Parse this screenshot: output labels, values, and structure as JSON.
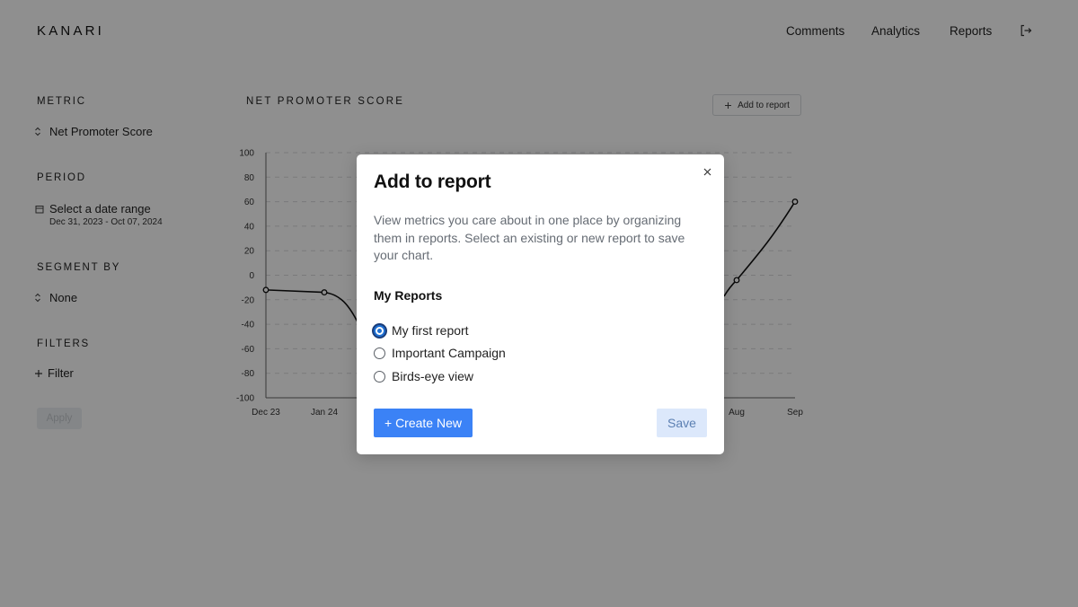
{
  "header": {
    "logo": "KANARI",
    "nav": [
      {
        "label": "Comments"
      },
      {
        "label": "Analytics"
      },
      {
        "label": "Reports"
      }
    ]
  },
  "sidebar": {
    "metric_title": "METRIC",
    "metric_value": "Net Promoter Score",
    "period_title": "PERIOD",
    "period_placeholder": "Select a date range",
    "period_range": "Dec 31, 2023 - Oct 07, 2024",
    "segment_title": "SEGMENT BY",
    "segment_value": "None",
    "filters_title": "FILTERS",
    "filter_label": "Filter",
    "apply_label": "Apply"
  },
  "chart": {
    "title": "NET PROMOTER SCORE",
    "add_to_report_label": "Add to report"
  },
  "chart_data": {
    "type": "line",
    "title": "NET PROMOTER SCORE",
    "xlabel": "",
    "ylabel": "",
    "ylim": [
      -100,
      100
    ],
    "yticks": [
      100,
      80,
      60,
      40,
      20,
      0,
      -20,
      -40,
      -60,
      -80,
      -100
    ],
    "grid": true,
    "x_tick_labels": [
      "Dec 23",
      "Jan 24",
      "Aug",
      "Sep"
    ],
    "series": [
      {
        "values_visible": [
          {
            "x": "Dec 23",
            "y": -12
          },
          {
            "x": "Jan 24",
            "y": -14
          },
          {
            "x": "Aug",
            "y": -4
          },
          {
            "x": "Sep",
            "y": 60
          }
        ]
      }
    ]
  },
  "modal": {
    "title": "Add to report",
    "description": "View metrics you care about in one place by organizing them in reports. Select an existing or new report to save your chart.",
    "subtitle": "My Reports",
    "options": [
      {
        "label": "My first report",
        "checked": true
      },
      {
        "label": "Important Campaign",
        "checked": false
      },
      {
        "label": "Birds-eye view",
        "checked": false
      }
    ],
    "create_label": "+ Create New",
    "save_label": "Save"
  },
  "colors": {
    "primary": "#3b82f6",
    "primary_light": "#dce8fb",
    "overlay": "rgba(0,0,0,0.44)"
  }
}
